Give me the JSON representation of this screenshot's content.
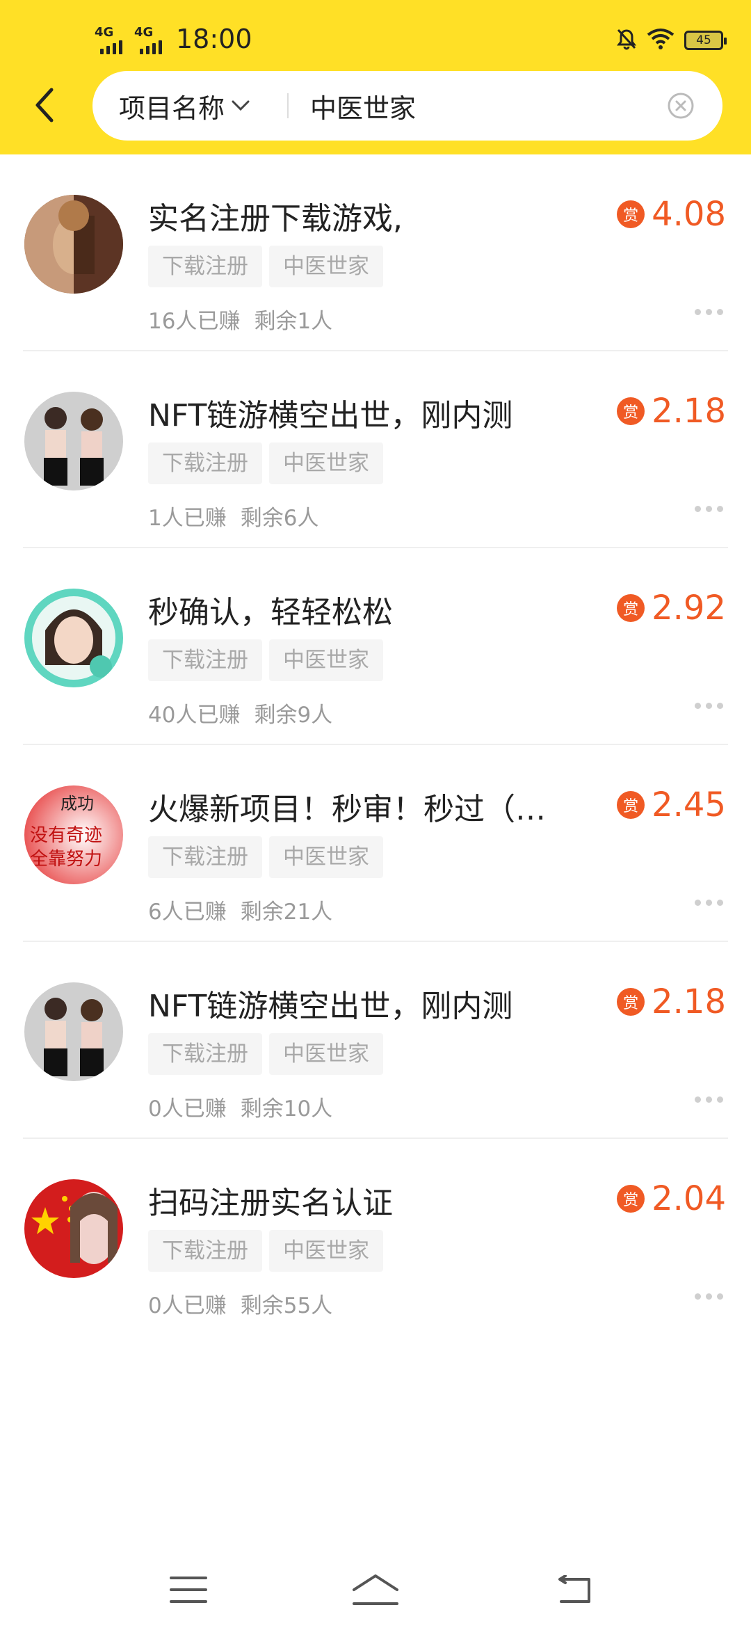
{
  "status": {
    "time": "18:00",
    "sim1_label": "4G",
    "sim2_label": "4G",
    "battery": "45"
  },
  "search": {
    "type_label": "项目名称",
    "query": "中医世家"
  },
  "colors": {
    "header": "#ffe026",
    "accent": "#f05a24"
  },
  "items": [
    {
      "title": "实名注册下载游戏,",
      "tags": [
        "下载注册",
        "中医世家"
      ],
      "earned": "16人已赚",
      "remaining": "剩余1人",
      "badge": "赏",
      "amount": "4.08",
      "avatar_icon": "portrait-painting-avatar"
    },
    {
      "title": "NFT链游横空出世，刚内测",
      "tags": [
        "下载注册",
        "中医世家"
      ],
      "earned": "1人已赚",
      "remaining": "剩余6人",
      "badge": "赏",
      "amount": "2.18",
      "avatar_icon": "two-women-avatar"
    },
    {
      "title": "秒确认，轻轻松松",
      "tags": [
        "下载注册",
        "中医世家"
      ],
      "earned": "40人已赚",
      "remaining": "剩余9人",
      "badge": "赏",
      "amount": "2.92",
      "avatar_icon": "woman-portrait-avatar"
    },
    {
      "title": "火爆新项目！秒审！秒过（…",
      "tags": [
        "下载注册",
        "中医世家"
      ],
      "earned": "6人已赚",
      "remaining": "剩余21人",
      "badge": "赏",
      "amount": "2.45",
      "avatar_icon": "motto-text-avatar"
    },
    {
      "title": "NFT链游横空出世，刚内测",
      "tags": [
        "下载注册",
        "中医世家"
      ],
      "earned": "0人已赚",
      "remaining": "剩余10人",
      "badge": "赏",
      "amount": "2.18",
      "avatar_icon": "two-women-avatar"
    },
    {
      "title": "扫码注册实名认证",
      "tags": [
        "下载注册",
        "中医世家"
      ],
      "earned": "0人已赚",
      "remaining": "剩余55人",
      "badge": "赏",
      "amount": "2.04",
      "avatar_icon": "flag-avatar"
    }
  ],
  "avatar_texts": {
    "motto_lines": [
      "成功",
      "没有奇迹",
      "全靠努力"
    ]
  }
}
